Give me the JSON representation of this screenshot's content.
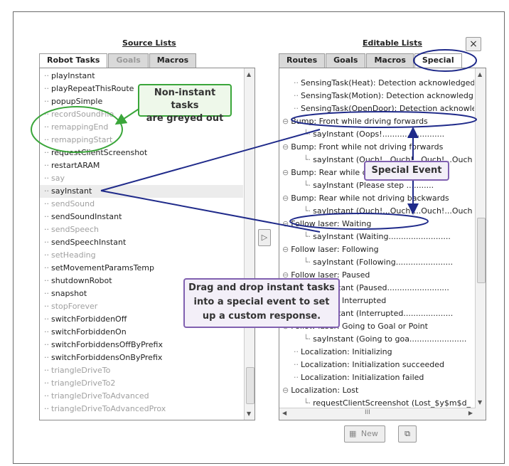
{
  "source": {
    "title": "Source Lists",
    "tabs": [
      {
        "label": "Robot Tasks",
        "state": "active"
      },
      {
        "label": "Goals",
        "state": "disabled"
      },
      {
        "label": "Macros",
        "state": "normal"
      }
    ],
    "items": [
      {
        "label": "playInstant",
        "grey": false
      },
      {
        "label": "playRepeatThisRoute",
        "grey": false
      },
      {
        "label": "popupSimple",
        "grey": false
      },
      {
        "label": "recordSoundFile",
        "grey": true
      },
      {
        "label": "remappingEnd",
        "grey": true
      },
      {
        "label": "remappingStart",
        "grey": true
      },
      {
        "label": "requestClientScreenshot",
        "grey": false
      },
      {
        "label": "restartARAM",
        "grey": false
      },
      {
        "label": "say",
        "grey": true
      },
      {
        "label": "sayInstant",
        "grey": false
      },
      {
        "label": "sendSound",
        "grey": true
      },
      {
        "label": "sendSoundInstant",
        "grey": false
      },
      {
        "label": "sendSpeech",
        "grey": true
      },
      {
        "label": "sendSpeechInstant",
        "grey": false
      },
      {
        "label": "setHeading",
        "grey": true
      },
      {
        "label": "setMovementParamsTemp",
        "grey": false
      },
      {
        "label": "shutdownRobot",
        "grey": false
      },
      {
        "label": "snapshot",
        "grey": false
      },
      {
        "label": "stopForever",
        "grey": true
      },
      {
        "label": "switchForbiddenOff",
        "grey": false
      },
      {
        "label": "switchForbiddenOn",
        "grey": false
      },
      {
        "label": "switchForbiddensOffByPrefix",
        "grey": false
      },
      {
        "label": "switchForbiddensOnByPrefix",
        "grey": false
      },
      {
        "label": "triangleDriveTo",
        "grey": true
      },
      {
        "label": "triangleDriveTo2",
        "grey": true
      },
      {
        "label": "triangleDriveToAdvanced",
        "grey": true
      },
      {
        "label": "triangleDriveToAdvancedProx",
        "grey": true
      }
    ]
  },
  "editable": {
    "title": "Editable Lists",
    "close_label": "×",
    "tabs": [
      {
        "label": "Routes"
      },
      {
        "label": "Goals"
      },
      {
        "label": "Macros"
      },
      {
        "label": "Special"
      }
    ],
    "items": [
      {
        "label": "SensingTask(Heat): Detection acknowledged",
        "level": 1,
        "node": false
      },
      {
        "label": "SensingTask(Motion): Detection acknowledg",
        "level": 1,
        "node": false
      },
      {
        "label": "SensingTask(OpenDoor): Detection acknowle",
        "level": 1,
        "node": false
      },
      {
        "label": "Bump: Front while driving forwards",
        "level": 0,
        "node": true
      },
      {
        "label": "sayInstant (Oops!.........................",
        "level": 2,
        "node": false
      },
      {
        "label": "Bump: Front while not driving forwards",
        "level": 0,
        "node": true
      },
      {
        "label": "sayInstant (Ouch!...Ouch!...Ouch!...Ouch",
        "level": 2,
        "node": false
      },
      {
        "label": "Bump: Rear while driving backwards",
        "level": 0,
        "node": true
      },
      {
        "label": "sayInstant (Please step ...........",
        "level": 2,
        "node": false
      },
      {
        "label": "Bump: Rear while not driving backwards",
        "level": 0,
        "node": true
      },
      {
        "label": "sayInstant (Ouch!...Ouch!...Ouch!...Ouch",
        "level": 2,
        "node": false
      },
      {
        "label": "Follow laser: Waiting",
        "level": 0,
        "node": true
      },
      {
        "label": "sayInstant (Waiting.........................",
        "level": 2,
        "node": false
      },
      {
        "label": "Follow laser: Following",
        "level": 0,
        "node": true
      },
      {
        "label": "sayInstant (Following.......................",
        "level": 2,
        "node": false
      },
      {
        "label": "Follow laser: Paused",
        "level": 0,
        "node": true
      },
      {
        "label": "sayInstant (Paused.........................",
        "level": 2,
        "node": false
      },
      {
        "label": "Follow laser: Interrupted",
        "level": 0,
        "node": true
      },
      {
        "label": "sayInstant (Interrupted....................",
        "level": 2,
        "node": false
      },
      {
        "label": "Follow laser: Going to Goal or Point",
        "level": 0,
        "node": true
      },
      {
        "label": "sayInstant (Going to goa.......................",
        "level": 2,
        "node": false
      },
      {
        "label": "Localization: Initializing",
        "level": 1,
        "node": false
      },
      {
        "label": "Localization: Initialization succeeded",
        "level": 1,
        "node": false
      },
      {
        "label": "Localization: Initialization failed",
        "level": 1,
        "node": false
      },
      {
        "label": "Localization: Lost",
        "level": 0,
        "node": true
      },
      {
        "label": "requestClientScreenshot (Lost_$y$m$d_",
        "level": 2,
        "node": false
      }
    ],
    "new_label": "New",
    "scroll_mark": "III"
  },
  "callouts": {
    "greyed": "Non-instant tasks\nare greyed out",
    "special": "Special Event",
    "drag": "Drag and drop instant tasks\ninto a special event to set\nup a custom response."
  },
  "colors": {
    "green": "#3aa63a",
    "navy": "#1f2a8a",
    "purple": "#8060b0"
  }
}
